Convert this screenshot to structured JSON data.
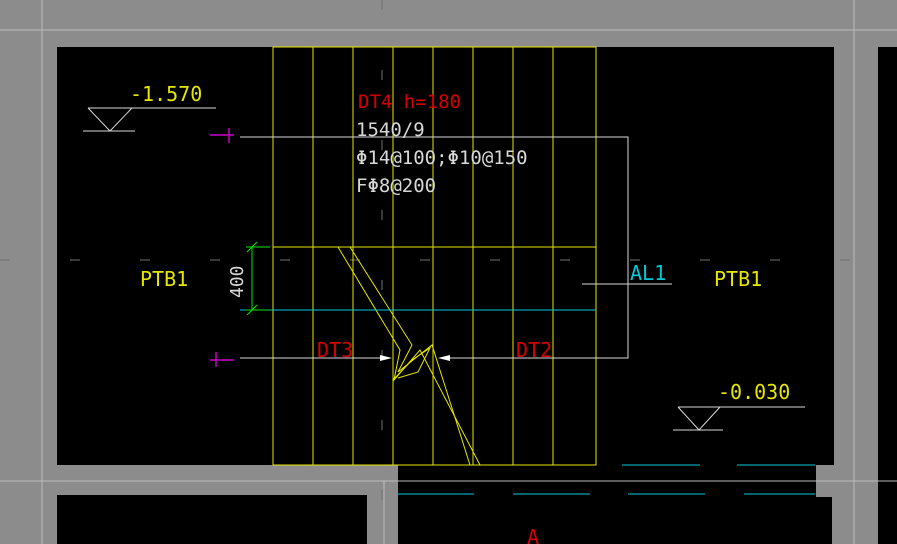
{
  "drawing": {
    "levels": {
      "top_left": "-1.570",
      "bottom_right": "-0.030"
    },
    "stair": {
      "name_height": "DT4 h=180",
      "step_spec": "1540/9",
      "main_rebar": "Φ14@100;Φ10@150",
      "dist_rebar": "FΦ8@200"
    },
    "labels": {
      "slab_left": "PTB1",
      "slab_right": "PTB1",
      "landing_beam": "AL1",
      "flight_left": "DT3",
      "flight_right": "DT2",
      "dimension_400": "400",
      "grid_bottom": "A"
    },
    "colors": {
      "background": "#000000",
      "wall_gray": "#8c8c8c",
      "stair_yellow": "#e6e600",
      "text_red": "#d40000",
      "text_white": "#d8d8d8",
      "text_cyan": "#00c8d8",
      "dim_green": "#00e600",
      "section_magenta": "#c800c8"
    }
  }
}
